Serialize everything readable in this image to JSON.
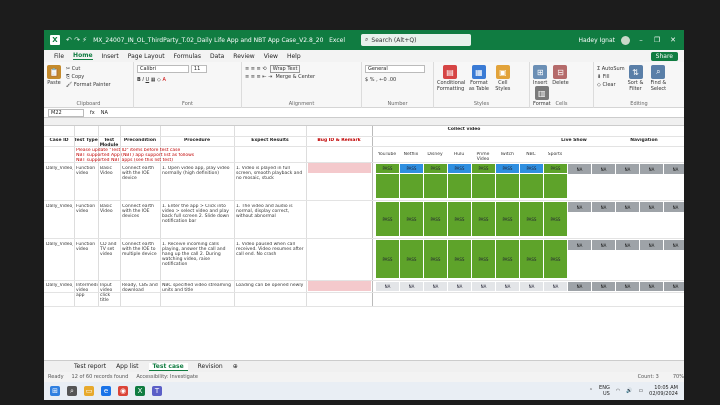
{
  "titlebar": {
    "app_letter": "X",
    "qa_icons": "↶ ↷ ⚡",
    "file_name": "MX_24007_IN_OL_ThirdParty_T.02_Daily Life App and NBT App Case_V2.8_20221018",
    "app_name": "Excel",
    "search_placeholder": "Search (Alt+Q)",
    "user_name": "Hadey Ignat"
  },
  "tabs": [
    "File",
    "Home",
    "Insert",
    "Page Layout",
    "Formulas",
    "Data",
    "Review",
    "View",
    "Help"
  ],
  "share_label": "Share",
  "ribbon": {
    "clipboard": {
      "paste": "Paste",
      "cut": "Cut",
      "copy": "Copy",
      "painter": "Format Painter",
      "group": "Clipboard"
    },
    "font": {
      "name": "Calibri",
      "size": "11",
      "group": "Font"
    },
    "alignment": {
      "wrap": "Wrap Text",
      "merge": "Merge & Center",
      "group": "Alignment"
    },
    "number": {
      "format": "General",
      "group": "Number"
    },
    "styles": {
      "cond": "Conditional Formatting",
      "table": "Format as Table",
      "cell": "Cell Styles",
      "group": "Styles"
    },
    "cells": {
      "insert": "Insert",
      "delete": "Delete",
      "format": "Format",
      "group": "Cells"
    },
    "editing": {
      "autosum": "AutoSum",
      "fill": "Fill",
      "clear": "Clear",
      "sort": "Sort & Filter",
      "find": "Find & Select",
      "group": "Editing"
    }
  },
  "formula_bar": {
    "name_box": "M22",
    "fx": "fx",
    "value": "NA"
  },
  "table": {
    "headers": [
      "Case ID",
      "Test Type",
      "Test Module",
      "Precondition",
      "Procedure",
      "Expect Results",
      "Bug ID & Remark"
    ],
    "group_headers": [
      "Collect video",
      "Live Show",
      "Navigation"
    ],
    "sub_headers": [
      "YouTube",
      "Netflix",
      "Disney",
      "Hulu",
      "Prime Video",
      "Twitch",
      "NBC",
      "Sports"
    ],
    "red_notes": [
      "Please update \"Test ID\" items before test case",
      "NBT supported App (NBT) app support list as follows",
      "NBT supported NBT apps (see this list test)"
    ],
    "rows": [
      {
        "id": "Dally_Video_001",
        "type": "Function video",
        "module": "Basic Video",
        "pre": "Connect earth with the IOE device",
        "proc": "1. Open video app, play video normally (high definition)",
        "expect": "1. Video is played in full screen, smooth playback and no mosaic, stuck"
      },
      {
        "id": "Dally_Video_002",
        "type": "Function video",
        "module": "Basic Video",
        "pre": "Connect earth with the IOE devices",
        "proc": "1. Enter the app > Click into video > select video and play back full screen 2. Slide down notification bar",
        "expect": "1. The video and audio is normal, display correct, without abnormal"
      },
      {
        "id": "Dally_Video_003",
        "type": "Function video",
        "module": "CD and TV set video",
        "pre": "Connect earth with the IOE to multiple device",
        "proc": "1. Receive incoming calls playing, answer the call and hang up the call 2. During watching video, raise notification",
        "expect": "1. Video paused when call received. Video resumes after call end. No crash"
      },
      {
        "id": "Dally_Video_004",
        "type": "Intermediate video app",
        "module": "Input video click title",
        "pre": "Ready, CBS and download",
        "proc": "NBC specified video streaming units and title",
        "expect": "Loading can be opened newly"
      }
    ],
    "pass_label": "PASS",
    "na_label": "NA"
  },
  "sheet_tabs": [
    "Test report",
    "App list",
    "Test case",
    "Revision"
  ],
  "active_sheet": "Test case",
  "status": {
    "ready": "Ready",
    "records": "12 of 60 records found",
    "accessibility": "Accessibility: Investigate",
    "count": "Count: 3",
    "zoom": "70%"
  },
  "taskbar": {
    "lang_top": "ENG",
    "lang_bottom": "US",
    "time": "10:05 AM",
    "date": "02/09/2024"
  },
  "colors": {
    "excel_green": "#107c41",
    "pass_green": "#5ea32a",
    "blue_cell": "#2f8fe0",
    "gray_cell": "#9ea3a8",
    "pink_cell": "#f4c9cc"
  }
}
